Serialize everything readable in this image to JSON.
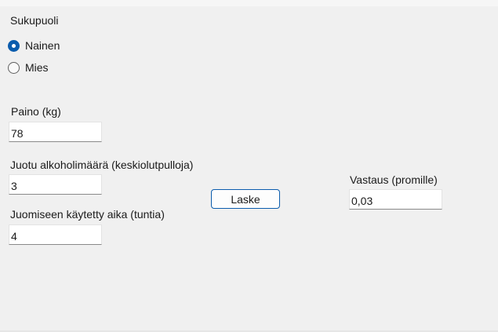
{
  "gender": {
    "title": "Sukupuoli",
    "options": [
      {
        "label": "Nainen",
        "checked": true
      },
      {
        "label": "Mies",
        "checked": false
      }
    ]
  },
  "weight": {
    "label": "Paino (kg)",
    "value": "78"
  },
  "alcohol": {
    "label": "Juotu alkoholimäärä (keskiolutpulloja)",
    "value": "3"
  },
  "time": {
    "label": "Juomiseen käytetty aika (tuntia)",
    "value": "4"
  },
  "calculate_button": {
    "label": "Laske"
  },
  "result": {
    "label": "Vastaus (promille)",
    "value": "0,03"
  },
  "colors": {
    "accent": "#0b5cad",
    "background": "#f0f0f0"
  }
}
